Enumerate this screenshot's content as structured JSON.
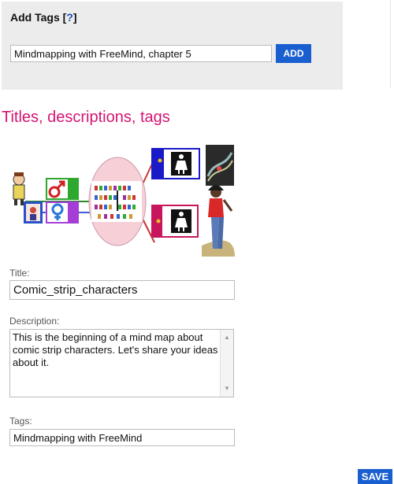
{
  "add_tags": {
    "title": "Add Tags [",
    "help_link": "?",
    "title_end": "]",
    "input_value": "Mindmapping with FreeMind, chapter 5",
    "add_button": "ADD"
  },
  "section_heading": "Titles, descriptions, tags",
  "image": {
    "icon": "mind-map-image",
    "alt": "Comic strip characters mind map"
  },
  "title_field": {
    "label": "Title:",
    "value": "Comic_strip_characters"
  },
  "description_field": {
    "label": "Description:",
    "value": "This is the beginning of a mind map about comic strip characters. Let's share your ideas about it."
  },
  "tags_field": {
    "label": "Tags:",
    "value": "Mindmapping with FreeMind"
  },
  "save_button": "SAVE",
  "colors": {
    "accent_blue": "#1a5fd0",
    "heading_pink": "#d41473",
    "panel_bg": "#ececec"
  }
}
